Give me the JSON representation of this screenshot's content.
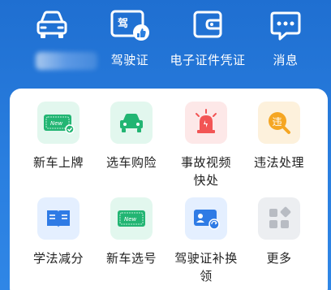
{
  "top_nav": [
    {
      "label": "驾驶证",
      "icon": "license-badge-icon"
    },
    {
      "label": "电子证件凭证",
      "icon": "wallet-icon"
    },
    {
      "label": "消息",
      "icon": "chat-bubble-icon"
    }
  ],
  "services": [
    {
      "label": "新车上牌",
      "icon": "new-plate-icon"
    },
    {
      "label": "选车购险",
      "icon": "car-insurance-icon"
    },
    {
      "label": "事故视频快处",
      "icon": "alarm-light-icon"
    },
    {
      "label": "违法处理",
      "icon": "violation-search-icon",
      "badge": "违"
    },
    {
      "label": "学法减分",
      "icon": "book-icon"
    },
    {
      "label": "新车选号",
      "icon": "plate-select-icon"
    },
    {
      "label": "驾驶证补换领",
      "icon": "license-card-icon"
    },
    {
      "label": "更多",
      "icon": "more-grid-icon"
    }
  ],
  "colors": {
    "header_blue": "#1f6fd1",
    "green": "#22b573",
    "red": "#f25555",
    "orange": "#f5a623",
    "blue": "#2f7be5",
    "grey": "#b8bcc3"
  }
}
